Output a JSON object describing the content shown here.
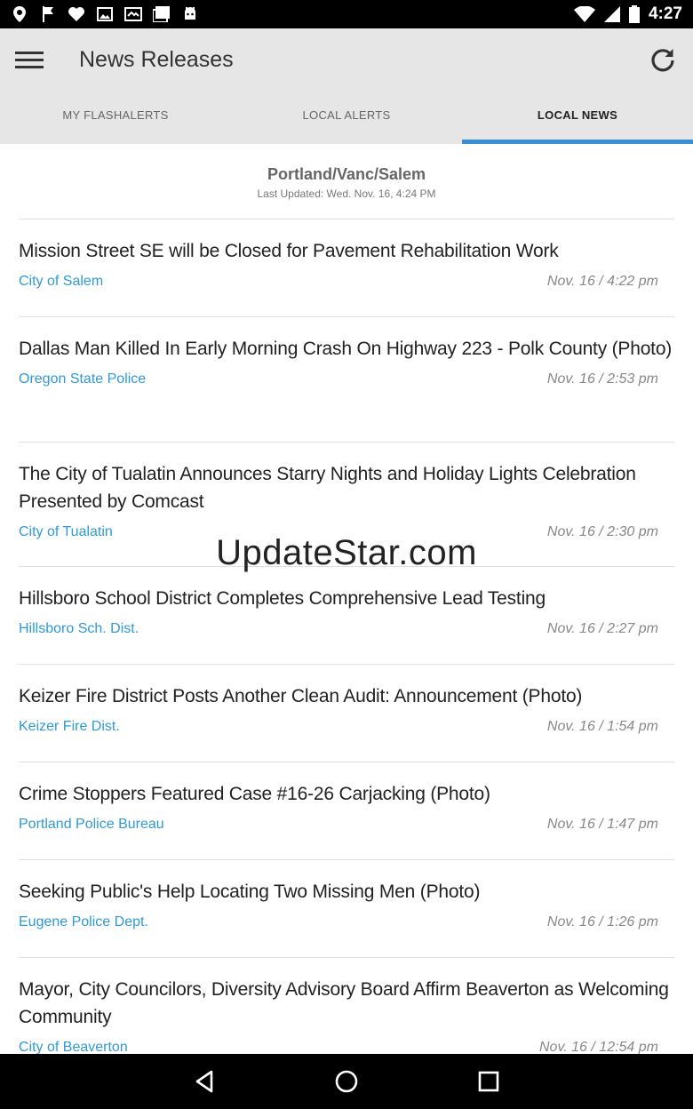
{
  "status_bar": {
    "time": "4:27",
    "left_icons": [
      "location-pin-icon",
      "flag-icon",
      "heart-icon",
      "image-icon",
      "mail-icon",
      "photos-icon",
      "android-icon"
    ],
    "right_icons": [
      "wifi-icon",
      "signal-icon",
      "battery-icon"
    ]
  },
  "app_bar": {
    "title": "News Releases"
  },
  "tabs": [
    {
      "label": "MY FLASHALERTS",
      "active": false
    },
    {
      "label": "LOCAL ALERTS",
      "active": false
    },
    {
      "label": "LOCAL NEWS",
      "active": true
    }
  ],
  "feed": {
    "region": "Portland/Vanc/Salem",
    "last_updated": "Last Updated: Wed. Nov. 16, 4:24 PM",
    "items": [
      {
        "title": "Mission Street SE will be Closed for Pavement Rehabilitation Work",
        "source": "City of Salem",
        "time": "Nov. 16 / 4:22 pm"
      },
      {
        "title": "Dallas Man Killed In Early Morning Crash On Highway 223 - Polk County (Photo)",
        "source": "Oregon State Police",
        "time": "Nov. 16 / 2:53 pm"
      },
      {
        "title": "The City of Tualatin Announces Starry Nights and Holiday Lights Celebration Presented by Comcast",
        "source": "City of Tualatin",
        "time": "Nov. 16 / 2:30 pm"
      },
      {
        "title": "Hillsboro School District Completes Comprehensive Lead Testing",
        "source": "Hillsboro Sch. Dist.",
        "time": "Nov. 16 / 2:27 pm"
      },
      {
        "title": "Keizer Fire District Posts Another Clean Audit: Announcement (Photo)",
        "source": "Keizer Fire Dist.",
        "time": "Nov. 16 / 1:54 pm"
      },
      {
        "title": "Crime Stoppers Featured Case #16-26 Carjacking (Photo)",
        "source": "Portland Police Bureau",
        "time": "Nov. 16 / 1:47 pm"
      },
      {
        "title": "Seeking Public's Help Locating Two Missing Men (Photo)",
        "source": "Eugene Police Dept.",
        "time": "Nov. 16 / 1:26 pm"
      },
      {
        "title": "Mayor, City Councilors, Diversity Advisory Board Affirm Beaverton as Welcoming Community",
        "source": "City of Beaverton",
        "time": "Nov. 16 / 12:54 pm"
      }
    ]
  },
  "watermark": "UpdateStar.com",
  "colors": {
    "accent": "#3a8fd6",
    "source_link": "#2f9ad8",
    "app_bar_bg": "#e6e6e6"
  }
}
